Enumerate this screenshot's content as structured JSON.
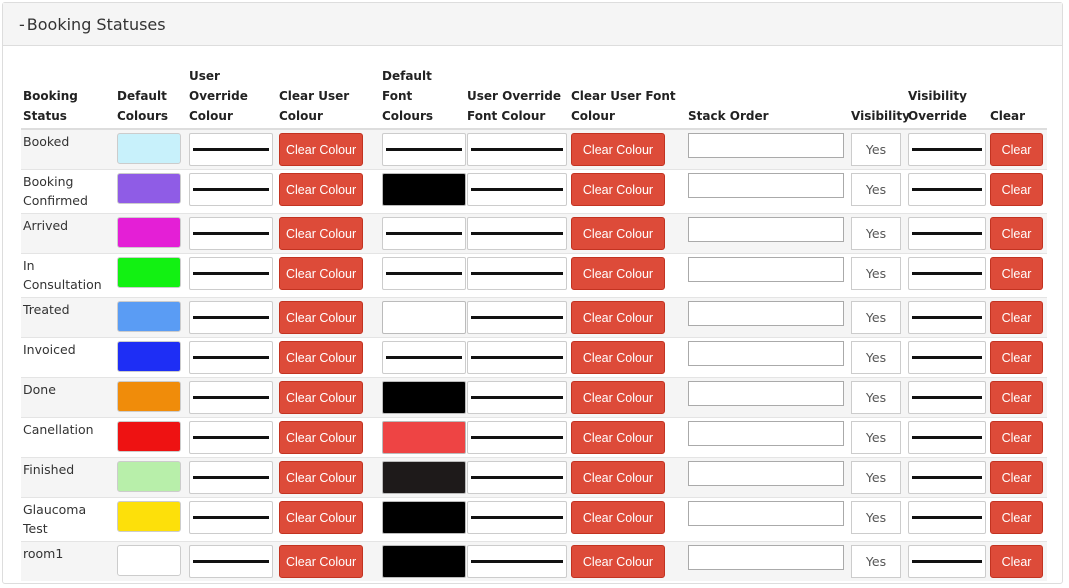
{
  "panel": {
    "collapse": "-",
    "title": "Booking Statuses"
  },
  "headers": {
    "status": [
      "Booking",
      "Status"
    ],
    "default_colours": [
      "Default",
      "Colours"
    ],
    "user_override_colour": [
      "User Override",
      "Colour"
    ],
    "clear_user_colour": [
      "Clear User",
      "Colour"
    ],
    "default_font_colours": [
      "Default Font",
      "Colours"
    ],
    "user_override_font_colour": [
      "User Override",
      "Font Colour"
    ],
    "clear_user_font_colour": [
      "Clear User Font",
      "Colour"
    ],
    "stack_order": [
      "",
      "Stack Order"
    ],
    "visibility": [
      "",
      "Visibility"
    ],
    "visibility_override": [
      "Visibility",
      "Override"
    ],
    "clear": [
      "",
      "Clear"
    ]
  },
  "labels": {
    "clear_colour": "Clear Colour",
    "clear": "Clear",
    "yes": "Yes"
  },
  "rows": [
    {
      "status": "Booked",
      "colour": "#c8f1fb",
      "font_colour": null
    },
    {
      "status": "Booking Confirmed",
      "colour": "#8f5ce6",
      "font_colour": "#000000"
    },
    {
      "status": "Arrived",
      "colour": "#e41fd6",
      "font_colour": null
    },
    {
      "status": "In Consultation",
      "colour": "#12f112",
      "font_colour": null
    },
    {
      "status": "Treated",
      "colour": "#5a9cf4",
      "font_colour": "#ffffff"
    },
    {
      "status": "Invoiced",
      "colour": "#1e2ef5",
      "font_colour": null
    },
    {
      "status": "Done",
      "colour": "#f08c0a",
      "font_colour": "#000000"
    },
    {
      "status": "Canellation",
      "colour": "#ee1212",
      "font_colour": "#ee4444"
    },
    {
      "status": "Finished",
      "colour": "#b8efaa",
      "font_colour": "#1e1a1a"
    },
    {
      "status": "Glaucoma Test",
      "colour": "#fde00a",
      "font_colour": "#000000"
    },
    {
      "status": "room1",
      "colour": "#ffffff",
      "font_colour": "#000000"
    }
  ]
}
